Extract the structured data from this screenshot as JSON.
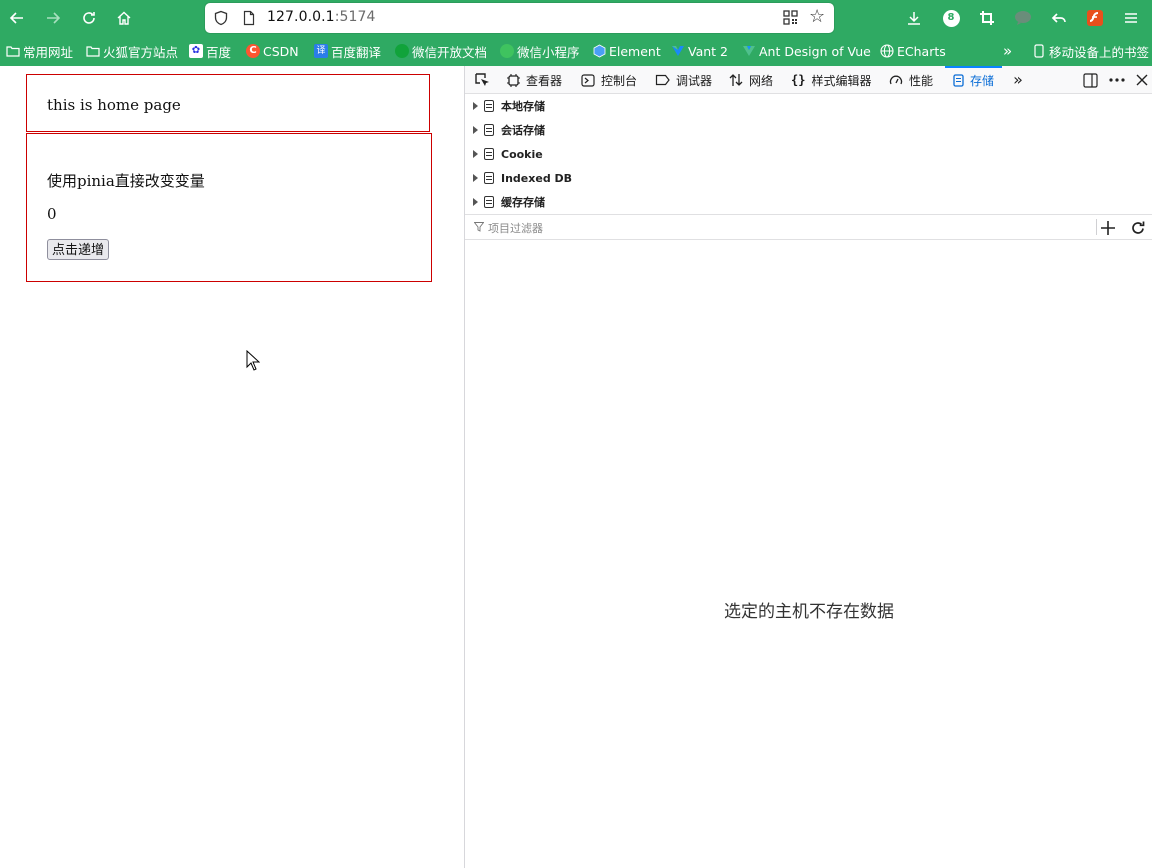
{
  "browser": {
    "url_host": "127.0.0.1",
    "url_port": ":5174",
    "badge_count": "8"
  },
  "bookmarks": [
    {
      "label": "常用网址",
      "icon": "folder-icon"
    },
    {
      "label": "火狐官方站点",
      "icon": "folder-icon"
    },
    {
      "label": "百度",
      "icon": "baidu-icon"
    },
    {
      "label": "CSDN",
      "icon": "csdn-icon"
    },
    {
      "label": "百度翻译",
      "icon": "translate-icon"
    },
    {
      "label": "微信开放文档",
      "icon": "wechat-icon"
    },
    {
      "label": "微信小程序",
      "icon": "miniprogram-icon"
    },
    {
      "label": "Element",
      "icon": "element-icon"
    },
    {
      "label": "Vant 2",
      "icon": "vant-icon"
    },
    {
      "label": "Ant Design of Vue",
      "icon": "antd-icon"
    },
    {
      "label": "ECharts",
      "icon": "globe-icon"
    }
  ],
  "bookmarks_mobile": "移动设备上的书签",
  "page": {
    "home_text": "this is home page",
    "section_title": "使用pinia直接改变变量",
    "count": "0",
    "increment_button": "点击递增"
  },
  "devtools": {
    "tabs": [
      {
        "label": "查看器"
      },
      {
        "label": "控制台"
      },
      {
        "label": "调试器"
      },
      {
        "label": "网络"
      },
      {
        "label": "样式编辑器"
      },
      {
        "label": "性能"
      },
      {
        "label": "存储"
      }
    ],
    "active_tab": "存储",
    "storage_tree": [
      {
        "label": "本地存储"
      },
      {
        "label": "会话存储"
      },
      {
        "label": "Cookie"
      },
      {
        "label": "Indexed DB"
      },
      {
        "label": "缓存存储"
      }
    ],
    "filter_placeholder": "项目过滤器",
    "empty_message": "选定的主机不存在数据"
  },
  "colors": {
    "toolbar": "#2faa63",
    "page_border": "#cc0000",
    "active_tab": "#0a84ff"
  }
}
